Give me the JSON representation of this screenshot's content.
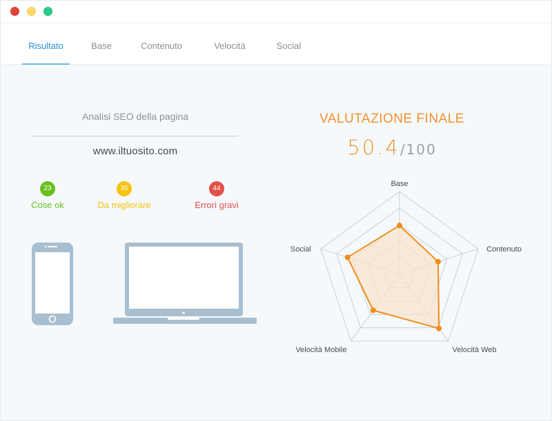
{
  "tabs": [
    {
      "label": "Risultato",
      "active": true
    },
    {
      "label": "Base",
      "active": false
    },
    {
      "label": "Contenuto",
      "active": false
    },
    {
      "label": "Velocità",
      "active": false
    },
    {
      "label": "Social",
      "active": false
    }
  ],
  "analysis": {
    "title": "Analisi SEO della pagina",
    "site": "www.iltuosito.com"
  },
  "stats": [
    {
      "count": "23",
      "label": "Cose ok",
      "color": "#6abf1f"
    },
    {
      "count": "35",
      "label": "Da migliorare",
      "color": "#f5c30e"
    },
    {
      "count": "44",
      "label": "Errori gravi",
      "color": "#e0514a"
    }
  ],
  "devices": {
    "phone": "phone-icon",
    "laptop": "laptop-icon",
    "color": "#a9bfd0"
  },
  "score": {
    "title": "VALUTAZIONE FINALE",
    "value": "50.4",
    "max": "/100"
  },
  "chart_data": {
    "type": "radar",
    "axes": [
      "Base",
      "Contenuto",
      "Velocità Web",
      "Velocità Mobile",
      "Social"
    ],
    "values": [
      0.59,
      0.49,
      0.81,
      0.54,
      0.66
    ],
    "rings": 5,
    "range": [
      0,
      1
    ],
    "fill_color": "#f8e3cc",
    "line_color": "#f08c18",
    "grid_color": "#c9ced4"
  }
}
